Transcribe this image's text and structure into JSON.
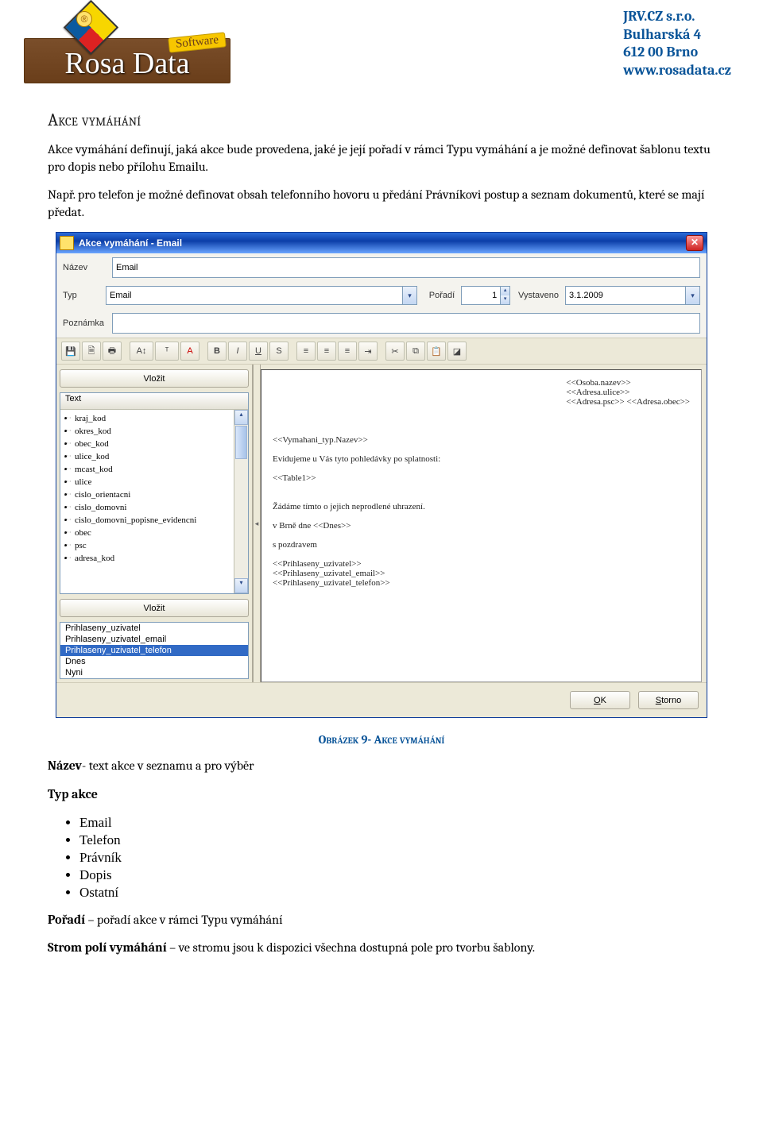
{
  "company": {
    "name": "JRV.CZ s.r.o.",
    "street": "Bulharská 4",
    "cityzip": "612 00 Brno",
    "web": "www.rosadata.cz"
  },
  "logo": {
    "main": "Rosa Data",
    "tag": "Software",
    "reg": "®"
  },
  "heading": "Akce vymáhání",
  "para1": "Akce vymáhání definují, jaká akce bude provedena, jaké je její pořadí v rámci  Typu vymáhání a je možné definovat šablonu textu pro dopis nebo přílohu Emailu.",
  "para2": "Např. pro telefon je možné definovat obsah telefonního hovoru u předání Právníkovi postup a seznam dokumentů, které se mají předat.",
  "caption": "Obrázek 9- Akce vymáhání",
  "def_nazev": {
    "term": "Název",
    "desc": "- text akce v seznamu a pro výběr"
  },
  "typ_heading": "Typ akce",
  "types": [
    "Email",
    "Telefon",
    "Právník",
    "Dopis",
    "Ostatní"
  ],
  "def_poradi": {
    "term": "Pořadí",
    "desc": " – pořadí akce v rámci Typu vymáhání"
  },
  "def_strom": {
    "term": "Strom polí vymáhání",
    "desc": " – ve stromu jsou k dispozici všechna dostupná pole pro tvorbu šablony."
  },
  "dlg": {
    "title": "Akce vymáhání - Email",
    "labels": {
      "nazev": "Název",
      "typ": "Typ",
      "poradi": "Pořadí",
      "vystaveno": "Vystaveno",
      "poznamka": "Poznámka"
    },
    "values": {
      "nazev": "Email",
      "typ": "Email",
      "poradi": "1",
      "vystaveno": "3.1.2009",
      "poznamka": ""
    },
    "vlozit": "Vložit",
    "treehdr": "Text",
    "tree": [
      "kraj_kod",
      "okres_kod",
      "obec_kod",
      "ulice_kod",
      "mcast_kod",
      "ulice",
      "cislo_orientacni",
      "cislo_domovni",
      "cislo_domovni_popisne_evidencni",
      "obec",
      "psc",
      "adresa_kod"
    ],
    "list": [
      "Prihlaseny_uzivatel",
      "Prihlaseny_uzivatel_email",
      "Prihlaseny_uzivatel_telefon",
      "Dnes",
      "Nyni"
    ],
    "list_selected_index": 2,
    "editor": {
      "right": [
        "<<Osoba.nazev>>",
        "<<Adresa.ulice>>",
        "<<Adresa.psc>> <<Adresa.obec>>"
      ],
      "body": [
        "",
        "",
        "",
        "<<Vymahani_typ.Nazev>>",
        "",
        "Evidujeme u Vás tyto pohledávky po splatnosti:",
        "",
        "<<Table1>>",
        "",
        "",
        "Žádáme tímto o jejich neprodlené uhrazení.",
        "",
        "v Brně dne <<Dnes>>",
        "",
        "s pozdravem",
        "",
        "<<Prihlaseny_uzivatel>>",
        "<<Prihlaseny_uzivatel_email>>",
        "<<Prihlaseny_uzivatel_telefon>>"
      ]
    },
    "buttons": {
      "ok": "OK",
      "cancel": "Storno"
    },
    "tbicons": [
      "save-icon",
      "new-icon",
      "print-icon",
      "font-size-icon",
      "font-style-icon",
      "font-color-icon",
      "bold-icon",
      "italic-icon",
      "underline-icon",
      "strike-icon",
      "align-left-icon",
      "align-center-icon",
      "align-right-icon",
      "indent-icon",
      "cut-icon",
      "copy-icon",
      "paste-icon",
      "object-icon"
    ]
  }
}
